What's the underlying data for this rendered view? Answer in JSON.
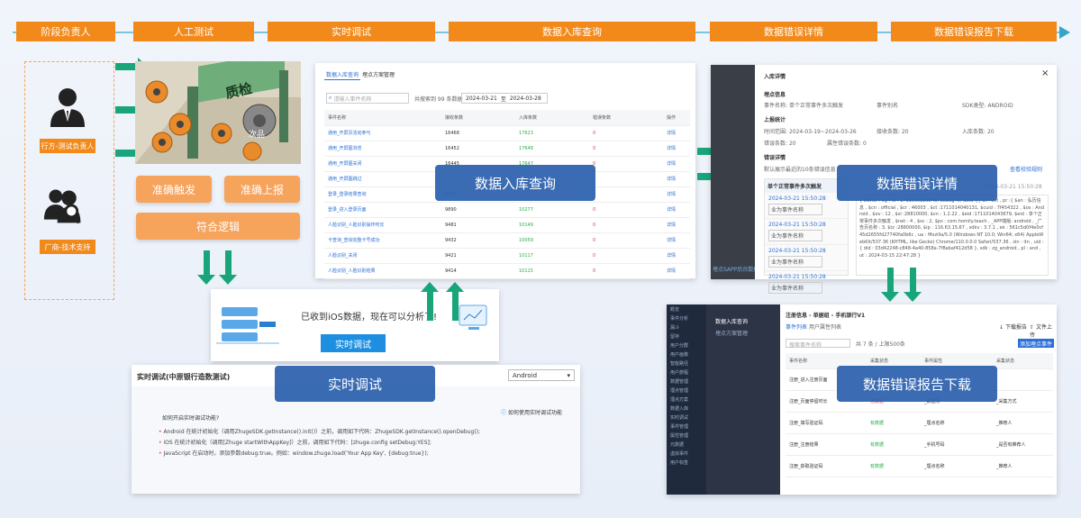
{
  "stages": [
    "阶段负责人",
    "人工测试",
    "实时调试",
    "数据入库查询",
    "数据错误详情",
    "数据错误报告下载"
  ],
  "roles": {
    "r1": "行方-测试负责人",
    "r2": "厂商-技术支持"
  },
  "illustration": {
    "gate": "质检",
    "item": "次品"
  },
  "buttons": {
    "b1": "准确触发",
    "b2": "准确上报",
    "b3": "符合逻辑"
  },
  "labels": {
    "l1": "数据入库查询",
    "l2": "数据错误详情",
    "l3": "实时调试",
    "l4": "数据错误报告下载"
  },
  "ios_banner": {
    "text": "已收到iOS数据，现在可以分析了!",
    "button": "实时调试"
  },
  "query_panel": {
    "tabs": [
      "数据入库查询",
      "埋点方案管理"
    ],
    "search_placeholder": "请输入事件名称",
    "summary": "共搜索到 99 条数据",
    "date_from": "2024-03-21",
    "date_sep": "至",
    "date_to": "2024-03-28",
    "columns": [
      "事件名称",
      "接收条数",
      "入库条数",
      "错误条数",
      "操作"
    ],
    "rows": [
      [
        "通用_开屏页活动参与",
        "16468",
        "17623",
        "0",
        "详情"
      ],
      [
        "通用_开屏图浏览",
        "16452",
        "17648",
        "0",
        "详情"
      ],
      [
        "通用_开屏图关闭",
        "16445",
        "17647",
        "0",
        "详情"
      ],
      [
        "通用_开屏图跳过",
        "",
        "",
        "0",
        "详情"
      ],
      [
        "登录_登录结果查询",
        "9688",
        "",
        "0",
        "详情"
      ],
      [
        "登录_进入登录页面",
        "9890",
        "10277",
        "0",
        "详情"
      ],
      [
        "人脸识别_人脸识别操作时长",
        "9481",
        "10149",
        "0",
        "详情"
      ],
      [
        "卡查询_查询完整卡号成功",
        "9432",
        "10059",
        "0",
        "详情"
      ],
      [
        "人脸识别_关闭",
        "9421",
        "10117",
        "0",
        "详情"
      ],
      [
        "人脸识别_人脸识别结果",
        "9414",
        "10115",
        "0",
        "详情"
      ]
    ]
  },
  "detail_panel": {
    "title": "入库详情",
    "sec1": "埋点信息",
    "event_label": "事件名称:",
    "event_value": "单个正常事件多次触发",
    "type_label": "事件别名",
    "sdk_label": "SDK类型:",
    "sdk_value": "ANDROID",
    "sec2": "上报统计",
    "time_label": "时间范围:",
    "time_value": "2024-03-19~2024-03-26",
    "recv_label": "接收条数:",
    "recv_value": "20",
    "in_label": "入库条数:",
    "in_value": "20",
    "err_label": "错误条数:",
    "err_value": "20",
    "attr_label": "属性错误条数:",
    "attr_value": "0",
    "sec3": "错误详情",
    "hint": "默认展示最近的10条错误信息",
    "link": "查看校验规则",
    "list_title": "单个正常事件多次触发",
    "items": [
      "2024-03-21 15:50:28",
      "2024-03-21 15:50:28",
      "2024-03-21 15:50:28",
      "2024-03-21 15:50:28"
    ],
    "tag": "业为事件名称",
    "stamp": "2024-03-21 15:50:28",
    "json": "{ owner : zg , id : 1711000229848, debug :0, data :[{ dt : evt , pr :{ $an : 弘历信息 , $cn : official , $cr : 46003 , $ct :1711014040131, $cuid : 7f454322 , $os : Android , $ov : 12 , $sl :28810000, $vn : 1.2.22 , $eid :1711014043679, $eid : 单个正常事件多次触发 , $net : 4 , $sc : 2, $ps : com.homily.teach , _APP端版: android , _广告页名称 : 3, $tz :28800000, $ip : 116.63.15.67 , sdkv : 3.7.1 , ek : 561c5d0f4e0cf45d2655fd27740fa0b6c , ua : Mozilla/5.0 (Windows NT 10.0; Win64; x64) AppleWebKit/537.36 (KHTML, like Gecko) Chrome/110.0.0.0 Safari/537.36 , sln : itn , uid :{ did : 03d42248-c848-4a40-858a-7f8abaf412d58 }, sdk : zg_android , pl : and , ut : 2024-03-15 22:47:28 }",
    "bg_text": "埋点SAPP后台数据APP"
  },
  "debug_panel": {
    "title": "实时调试(中原银行造数测试)",
    "select": "Android",
    "help": "如何使用实时调试功能",
    "question": "如何开启实时调试功能?",
    "lines": [
      "Android 在统计初始化（调用ZhugeSDK.getInstance().init()）之前，调用如下代码：ZhugeSDK.getInstance().openDebug();",
      "iOS 在统计初始化（调用[Zhuge startWithAppKey]）之前，调用如下代码：[zhuge.config setDebug:YES];",
      "JavaScript 在启动时，添加参数debug:true。例如：window.zhuge.load('Your App Key', {debug:true});"
    ]
  },
  "report_panel": {
    "title": "注册信息 - 单据组 - 手机银行V1",
    "tabs": [
      "事件列表",
      "用户属性列表"
    ],
    "search_placeholder": "搜索事件名称",
    "count": "共 7 条 / 上限500条",
    "btns": [
      "下载报告",
      "文件上传"
    ],
    "add_btn": "添加埋点事件",
    "columns": [
      "事件名称",
      "采集状态",
      "事件属性",
      "采集状态"
    ],
    "rows": [
      [
        "注册_进入注册页面",
        "有数据",
        "_姓名_",
        ""
      ],
      [
        "注册_页面停留时长",
        "无数据",
        "_数据项",
        "_采集方式"
      ],
      [
        "注册_填写验证码",
        "有数据",
        "_埋点名称",
        "_推荐人"
      ],
      [
        "注册_注册结果",
        "有数据",
        "_手机号码",
        "_是否有推荐人"
      ],
      [
        "注册_获取验证码",
        "有数据",
        "_埋点名称",
        "_推荐人"
      ]
    ],
    "sidebar": [
      "概览",
      "事件分析",
      "漏斗",
      "留存",
      "用户分群",
      "用户画像",
      "智能路径",
      "用户旅程",
      "数据管理",
      "埋点管理",
      "埋点方案",
      "数据入库",
      "实时调试",
      "事件管理",
      "属性管理",
      "元数据",
      "虚拟事件",
      "用户标签"
    ],
    "top": [
      "数据入库查询",
      "埋点方案管理"
    ]
  },
  "colors": {
    "orange": "#f28a1b",
    "green": "#18a57a",
    "blue": "#3266b0"
  }
}
